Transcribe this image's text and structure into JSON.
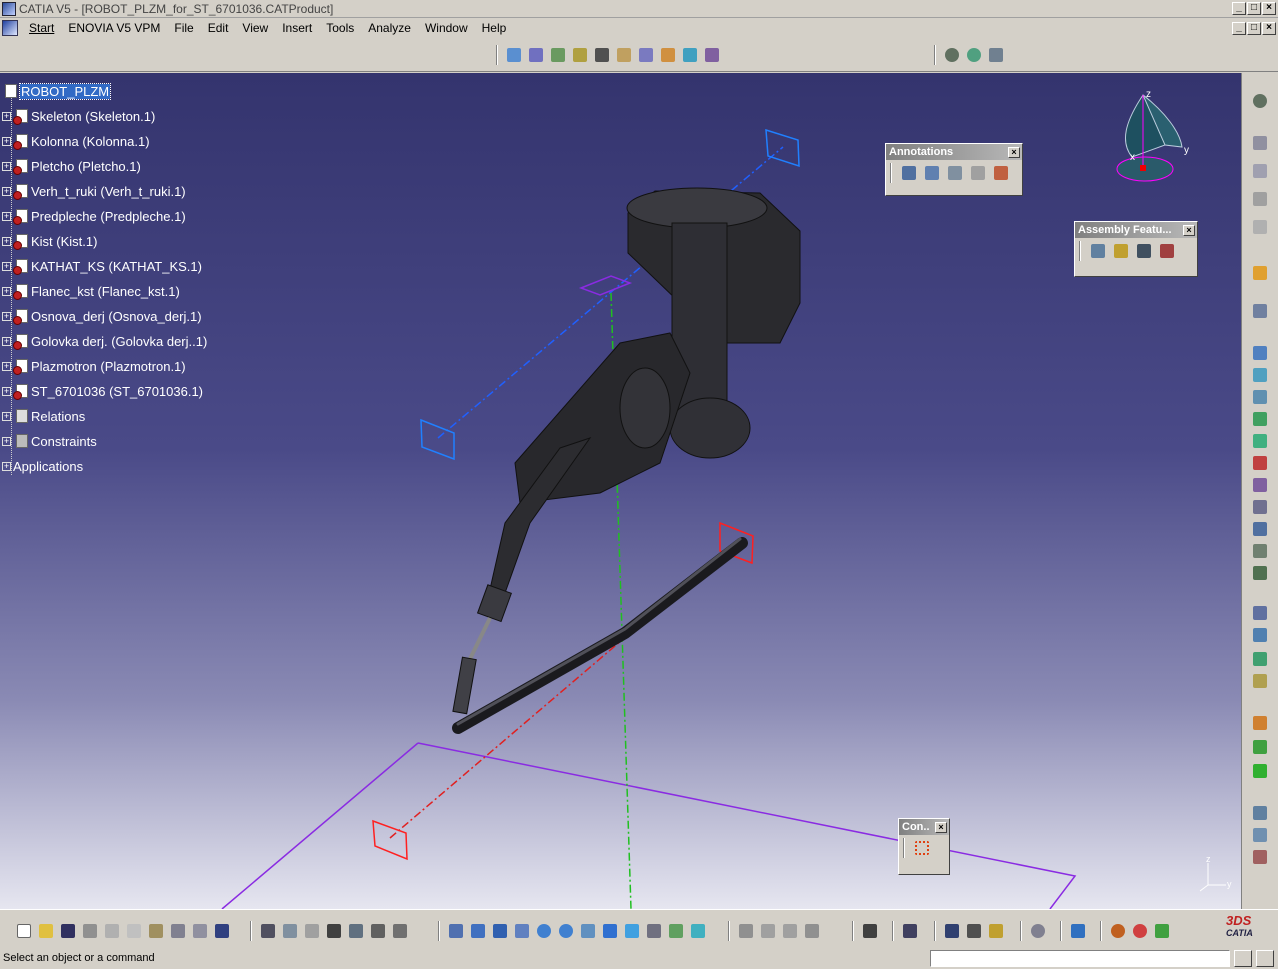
{
  "window": {
    "title": "CATIA V5 - [ROBOT_PLZM_for_ST_6701036.CATProduct]",
    "min": "_",
    "max": "□",
    "close": "×"
  },
  "menu": {
    "items": [
      "Start",
      "ENOVIA V5 VPM",
      "File",
      "Edit",
      "View",
      "Insert",
      "Tools",
      "Analyze",
      "Window",
      "Help"
    ]
  },
  "tree": {
    "root": "ROBOT_PLZM",
    "nodes": [
      "Skeleton (Skeleton.1)",
      "Kolonna (Kolonna.1)",
      "Pletcho (Pletcho.1)",
      "Verh_t_ruki (Verh_t_ruki.1)",
      "Predpleche (Predpleche.1)",
      "Kist (Kist.1)",
      "KATHAT_KS (KATHAT_KS.1)",
      "Flanec_kst (Flanec_kst.1)",
      "Osnova_derj (Osnova_derj.1)",
      "Golovka derj. (Golovka derj..1)",
      "Plazmotron (Plazmotron.1)",
      "ST_6701036 (ST_6701036.1)"
    ],
    "relations": "Relations",
    "constraints": "Constraints",
    "applications": "Applications"
  },
  "palettes": {
    "annotations": "Annotations",
    "assembly": "Assembly Featu...",
    "constraints": "Con..",
    "close": "×"
  },
  "compass": {
    "x": "x",
    "y": "y",
    "z": "z"
  },
  "axis_small": {
    "y": "y",
    "z": "z"
  },
  "status": {
    "message": "Select an object or a command",
    "input_placeholder": ""
  },
  "logo": {
    "ds": "3DS",
    "name": "CATIA"
  },
  "colors": {
    "viewport_top": "#34346e",
    "viewport_bottom": "#e6e6f0",
    "plane_blue": "#2060ff",
    "plane_red": "#e02020",
    "plane_violet": "#8a2be2",
    "axis_green": "#20c020"
  }
}
